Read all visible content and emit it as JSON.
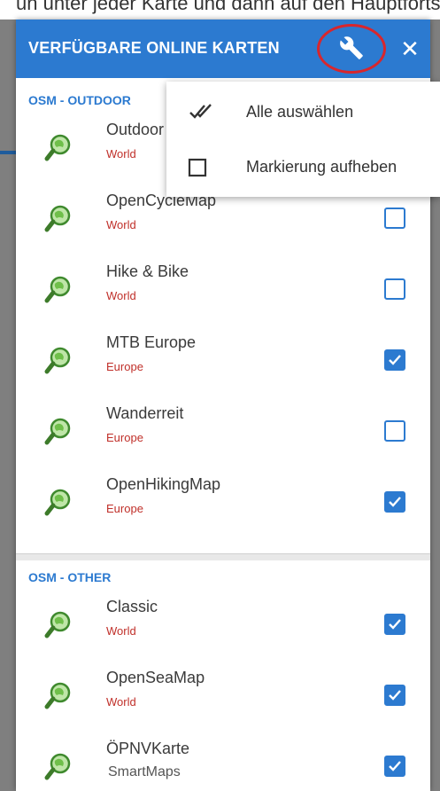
{
  "background": {
    "top_text": "un unter jeder Karte und dann auf den Hauptfortsetzungstitel"
  },
  "dialog": {
    "title": "VERFÜGBARE ONLINE KARTEN",
    "close_label": "✕",
    "header_color": "#2c7ad0",
    "highlight_color": "#d8262d"
  },
  "menu": {
    "items": [
      {
        "label": "Alle auswählen",
        "icon": "double-check-icon"
      },
      {
        "label": "Markierung aufheben",
        "icon": "checkbox-empty-icon"
      }
    ]
  },
  "sections": [
    {
      "title": "OSM - OUTDOOR",
      "maps": [
        {
          "name": "Outdoor",
          "region": "World",
          "checked": false
        },
        {
          "name": "OpenCycleMap",
          "region": "World",
          "checked": false
        },
        {
          "name": "Hike & Bike",
          "region": "World",
          "checked": false
        },
        {
          "name": "MTB Europe",
          "region": "Europe",
          "checked": true
        },
        {
          "name": "Wanderreit",
          "region": "Europe",
          "checked": false
        },
        {
          "name": "OpenHikingMap",
          "region": "Europe",
          "checked": true
        }
      ]
    },
    {
      "title": "OSM - OTHER",
      "maps": [
        {
          "name": "Classic",
          "region": "World",
          "checked": true
        },
        {
          "name": "OpenSeaMap",
          "region": "World",
          "checked": true
        },
        {
          "name": "ÖPNVKarte",
          "region": "",
          "checked": true
        }
      ]
    }
  ],
  "bottom_cut_text": "SmartMaps"
}
